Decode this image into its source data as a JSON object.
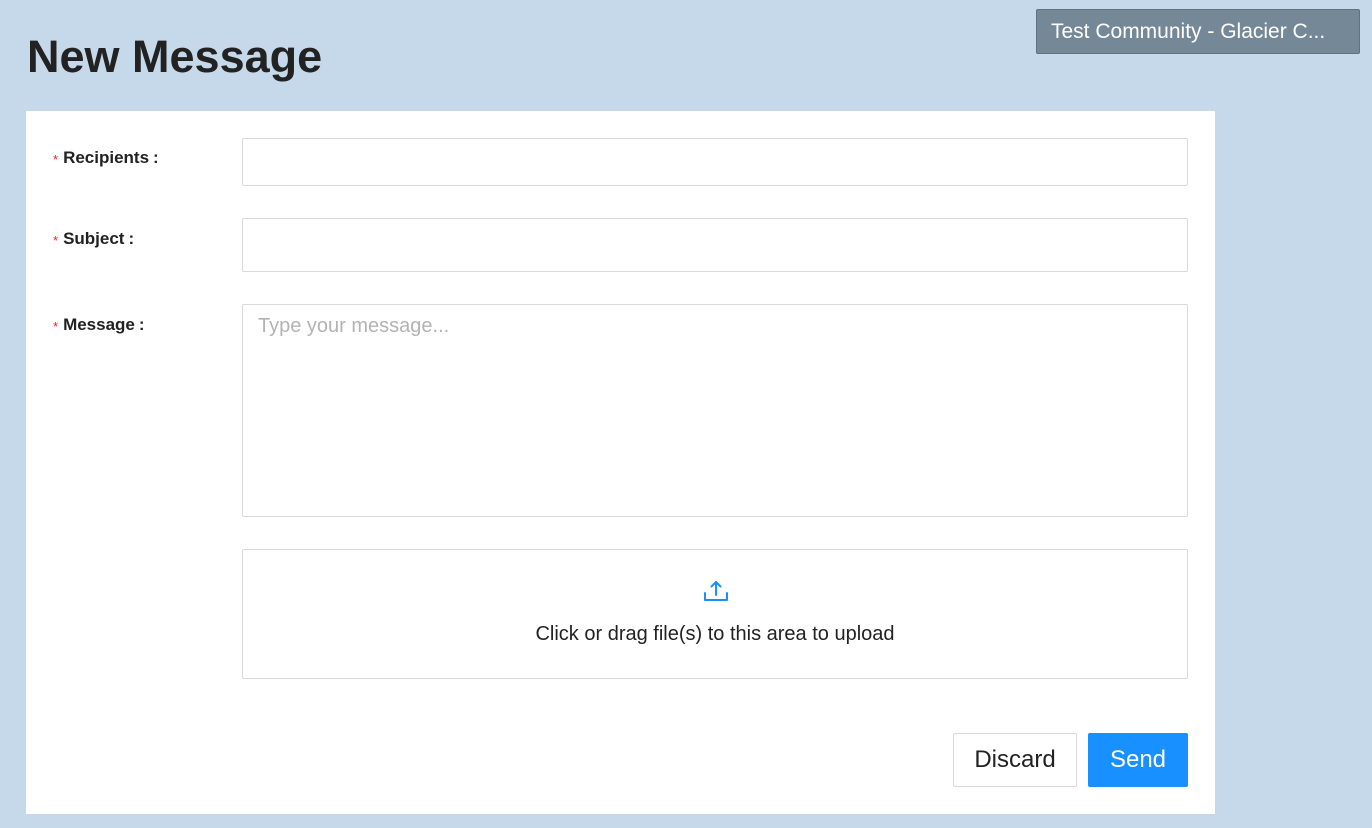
{
  "header": {
    "title": "New Message",
    "community_label": "Test Community - Glacier C..."
  },
  "form": {
    "recipients": {
      "label": "Recipients",
      "required_mark": "*",
      "colon": ":",
      "value": ""
    },
    "subject": {
      "label": "Subject",
      "required_mark": "*",
      "colon": ":",
      "value": ""
    },
    "message": {
      "label": "Message",
      "required_mark": "*",
      "colon": ":",
      "value": "",
      "placeholder": "Type your message..."
    },
    "upload": {
      "icon": "upload-icon",
      "text": "Click or drag file(s) to this area to upload"
    }
  },
  "actions": {
    "discard_label": "Discard",
    "send_label": "Send"
  },
  "colors": {
    "page_background": "#c6d9ea",
    "primary": "#1890ff",
    "required": "#f5222d",
    "community_button": "#758898"
  }
}
